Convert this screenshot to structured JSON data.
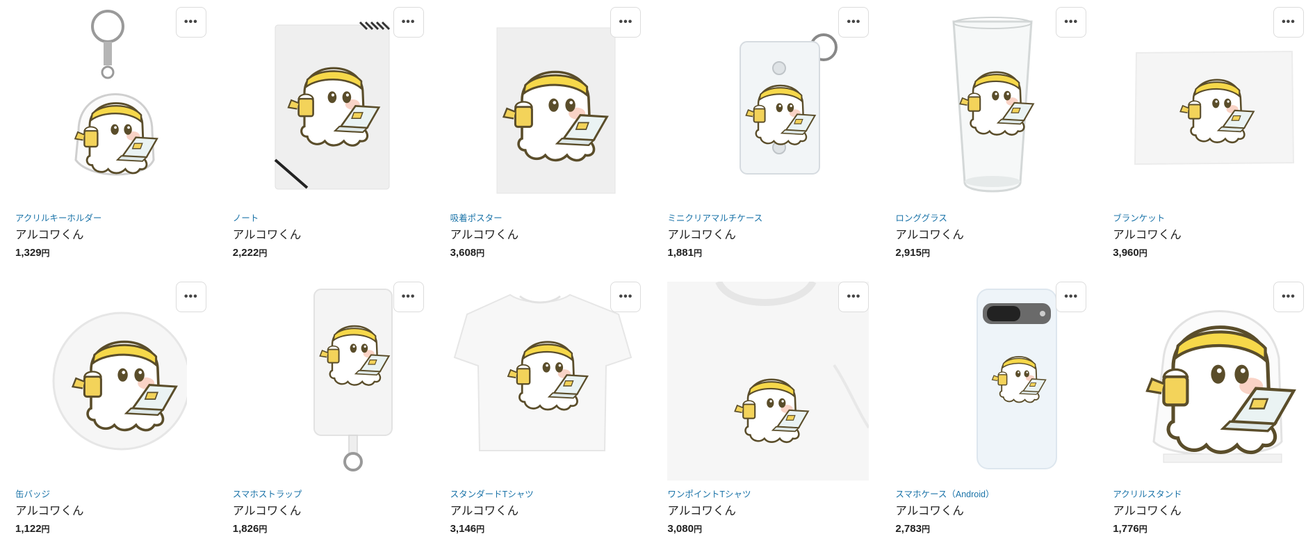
{
  "more_icon": "ellipsis-icon",
  "colors": {
    "category_link": "#1a73a8",
    "headband": "#f6d84a",
    "beer": "#f3d35a",
    "outline": "#5a4d2a"
  },
  "products": [
    {
      "category": "アクリルキーホルダー",
      "title": "アルコワくん",
      "price": "1,329",
      "currency": "円",
      "more": "•••"
    },
    {
      "category": "ノート",
      "title": "アルコワくん",
      "price": "2,222",
      "currency": "円",
      "more": "•••"
    },
    {
      "category": "吸着ポスター",
      "title": "アルコワくん",
      "price": "3,608",
      "currency": "円",
      "more": "•••"
    },
    {
      "category": "ミニクリアマルチケース",
      "title": "アルコワくん",
      "price": "1,881",
      "currency": "円",
      "more": "•••"
    },
    {
      "category": "ロンググラス",
      "title": "アルコワくん",
      "price": "2,915",
      "currency": "円",
      "more": "•••"
    },
    {
      "category": "ブランケット",
      "title": "アルコワくん",
      "price": "3,960",
      "currency": "円",
      "more": "•••"
    },
    {
      "category": "缶バッジ",
      "title": "アルコワくん",
      "price": "1,122",
      "currency": "円",
      "more": "•••"
    },
    {
      "category": "スマホストラップ",
      "title": "アルコワくん",
      "price": "1,826",
      "currency": "円",
      "more": "•••"
    },
    {
      "category": "スタンダードTシャツ",
      "title": "アルコワくん",
      "price": "3,146",
      "currency": "円",
      "more": "•••"
    },
    {
      "category": "ワンポイントTシャツ",
      "title": "アルコワくん",
      "price": "3,080",
      "currency": "円",
      "more": "•••"
    },
    {
      "category": "スマホケース（Android）",
      "title": "アルコワくん",
      "price": "2,783",
      "currency": "円",
      "more": "•••"
    },
    {
      "category": "アクリルスタンド",
      "title": "アルコワくん",
      "price": "1,776",
      "currency": "円",
      "more": "•••"
    }
  ]
}
